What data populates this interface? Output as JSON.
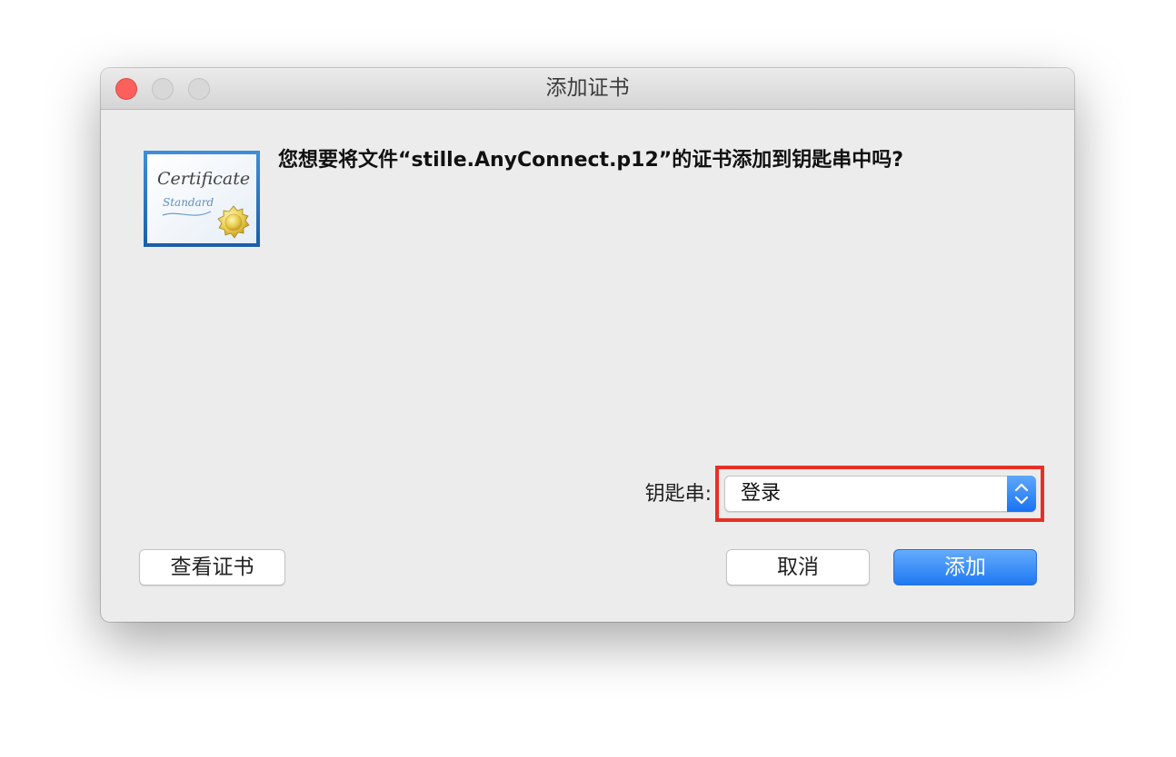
{
  "window": {
    "title": "添加证书"
  },
  "dialog": {
    "question": "您想要将文件“stille.AnyConnect.p12”的证书添加到钥匙串中吗?",
    "certificate_icon": "certificate-icon",
    "certificate_icon_text": {
      "line1": "Certificate",
      "line2": "Standard"
    }
  },
  "keychain": {
    "label": "钥匙串:",
    "selected": "登录"
  },
  "buttons": {
    "view_certificate": "查看证书",
    "cancel": "取消",
    "add": "添加"
  },
  "colors": {
    "accent": "#1f79f2",
    "highlight": "#e63024",
    "close": "#fc605c"
  }
}
